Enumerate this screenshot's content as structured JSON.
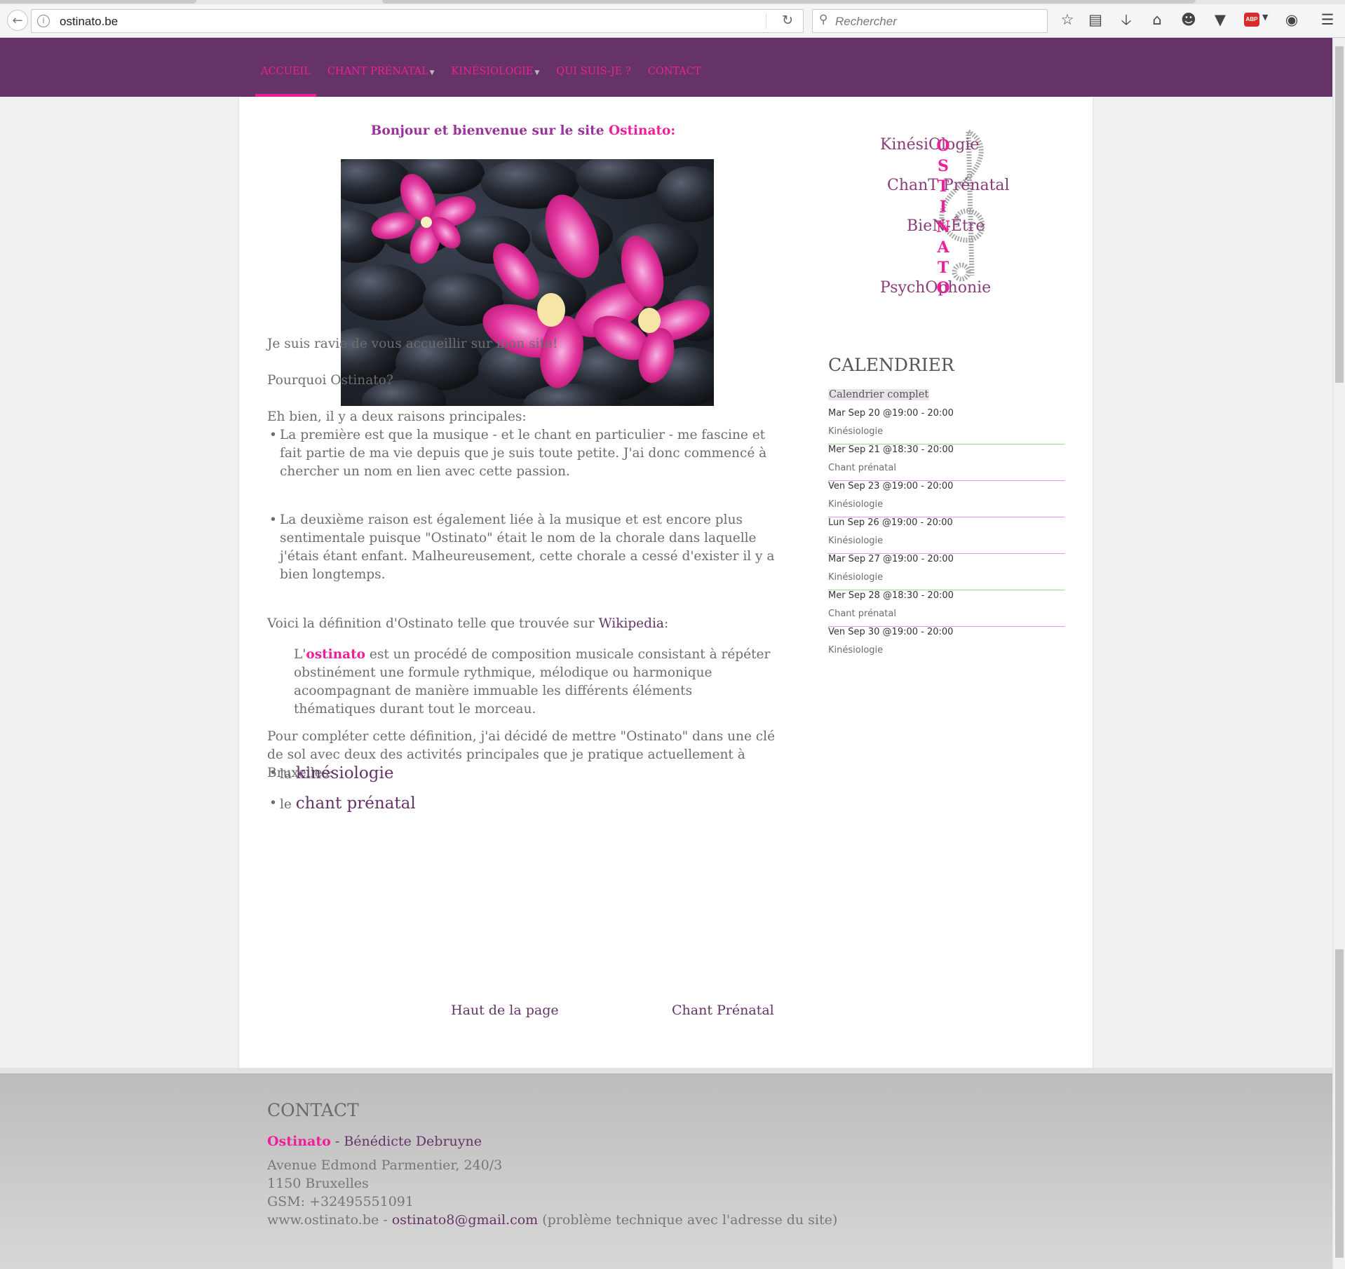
{
  "browser": {
    "url": "ostinato.be",
    "search_placeholder": "Rechercher",
    "abp_label": "ABP"
  },
  "nav": {
    "items": [
      {
        "label": "ACCUEIL",
        "active": true,
        "dropdown": false
      },
      {
        "label": "CHANT PRÉNATAL",
        "active": false,
        "dropdown": true
      },
      {
        "label": "KINÉSIOLOGIE",
        "active": false,
        "dropdown": true
      },
      {
        "label": "QUI SUIS-JE ?",
        "active": false,
        "dropdown": false
      },
      {
        "label": "CONTACT",
        "active": false,
        "dropdown": false
      }
    ]
  },
  "main": {
    "welcome_prefix": "Bonjour et bienvenue sur le site ",
    "welcome_name": "Ostinato:",
    "intro": "Je suis ravie de vous accueillir sur mon site!",
    "why": "Pourquoi Ostinato?",
    "reasons_intro": "Eh bien, il y a deux raisons principales:",
    "reason1": "La première est que la musique - et le chant en particulier - me fascine et fait partie de ma vie depuis que je suis toute petite.  J'ai donc commencé à chercher un nom en lien avec cette passion.",
    "reason2": "La deuxième raison est également liée à la musique et est encore plus sentimentale puisque \"Ostinato\" était le nom de la chorale dans laquelle j'étais étant enfant.  Malheureusement, cette chorale a cessé d'exister il y a bien longtemps.",
    "definition_intro": "Voici la définition d'Ostinato telle que trouvée sur ",
    "wikipedia": "Wikipedia",
    "colon": ":",
    "quote_prefix": "L'",
    "quote_term": "ostinato",
    "quote_rest": " est un procédé de composition musicale consistant à répéter obstinément une formule rythmique, mélodique ou harmonique acoompagnant de manière immuable les différents éléments thématiques durant tout le morceau.",
    "complete": "Pour compléter cette définition, j'ai décidé de mettre \"Ostinato\" dans une clé de sol avec deux des activités principales que je pratique actuellement à Bruxelles:",
    "activity1_prefix": "la ",
    "activity1_link": "kinésiologie",
    "activity2_prefix": "le ",
    "activity2_link": "chant prénatal",
    "top_link": "Haut de la page",
    "next_link": "Chant Prénatal"
  },
  "logo": {
    "line1": "KinésiOlogie",
    "line2": "ChanT Prénatal",
    "line3": "BieN-Être",
    "line4": "PsychOphonie",
    "vertical_letters": [
      "O",
      "S",
      "T",
      "I",
      "N",
      "A",
      "T",
      "O"
    ]
  },
  "calendar": {
    "title": "CALENDRIER",
    "full_link": "Calendrier complet",
    "events": [
      {
        "when": "Mar Sep 20 @19:00 - 20:00",
        "what": "Kinésiologie",
        "rule_color": "#90e090"
      },
      {
        "when": "Mer Sep 21 @18:30 - 20:00",
        "what": "Chant prénatal",
        "rule_color": "#e59ae5"
      },
      {
        "when": "Ven Sep 23 @19:00 - 20:00",
        "what": "Kinésiologie",
        "rule_color": "#e59ae5"
      },
      {
        "when": "Lun Sep 26 @19:00 - 20:00",
        "what": "Kinésiologie",
        "rule_color": "#e59ae5"
      },
      {
        "when": "Mar Sep 27 @19:00 - 20:00",
        "what": "Kinésiologie",
        "rule_color": "#90e090"
      },
      {
        "when": "Mer Sep 28 @18:30 - 20:00",
        "what": "Chant prénatal",
        "rule_color": "#e59ae5"
      },
      {
        "when": "Ven Sep 30 @19:00 - 20:00",
        "what": "Kinésiologie",
        "rule_color": ""
      }
    ]
  },
  "footer": {
    "title": "CONTACT",
    "brand": "Ostinato",
    "person": " - Bénédicte Debruyne",
    "address1": "Avenue Edmond Parmentier, 240/3",
    "address2": "1150 Bruxelles",
    "gsm": "GSM: +32495551091",
    "site": " www.ostinato.be - ",
    "email": "ostinato8@gmail.com",
    "note": " (problème technique avec l'adresse du site)"
  },
  "colors": {
    "nav_bg": "#663366",
    "accent_pink": "#ee1f9b",
    "link_purple": "#663366"
  }
}
